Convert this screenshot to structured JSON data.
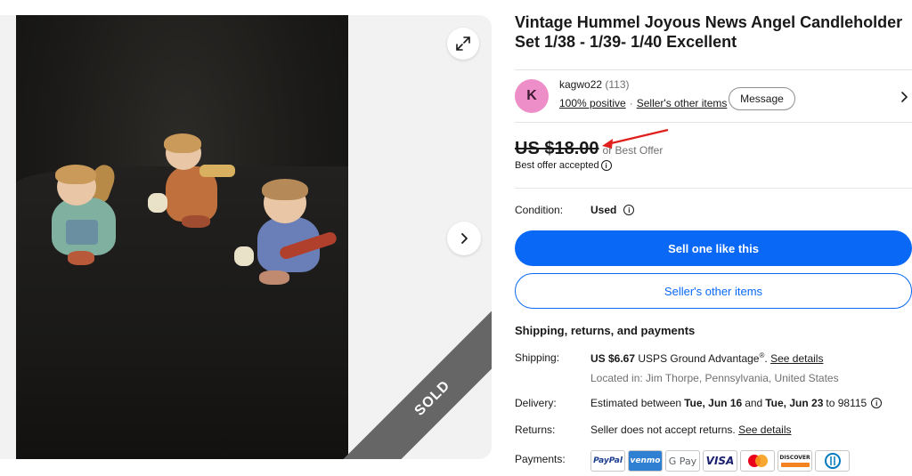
{
  "listing": {
    "title": "Vintage Hummel Joyous News Angel Candleholder Set 1/38 - 1/39- 1/40 Excellent",
    "sold_label": "SOLD"
  },
  "seller": {
    "avatar_letter": "K",
    "name": "kagwo22",
    "feedback_count": "(113)",
    "positive": "100% positive",
    "other_items": "Seller's other items",
    "message_label": "Message"
  },
  "price": {
    "amount": "US $18.00",
    "or_best_offer": "or Best Offer",
    "offer_accepted": "Best offer accepted"
  },
  "condition": {
    "label": "Condition:",
    "value": "Used"
  },
  "actions": {
    "sell_one": "Sell one like this",
    "sellers_other_items": "Seller's other items"
  },
  "details": {
    "section_title": "Shipping, returns, and payments",
    "shipping_label": "Shipping:",
    "shipping_price": "US $6.67",
    "shipping_service": "USPS Ground Advantage",
    "shipping_reg": "®",
    "see_details": "See details",
    "location": "Located in: Jim Thorpe, Pennsylvania, United States",
    "delivery_label": "Delivery:",
    "delivery_prefix": "Estimated between",
    "delivery_start": "Tue, Jun 16",
    "delivery_and": "and",
    "delivery_end": "Tue, Jun 23",
    "delivery_zip": "to 98115",
    "returns_label": "Returns:",
    "returns_text": "Seller does not accept returns.",
    "payments_label": "Payments:"
  },
  "payment_methods": [
    "PayPal",
    "venmo",
    "G Pay",
    "VISA",
    "Mastercard",
    "DISCOVER",
    "Diners Club"
  ],
  "colors": {
    "primary_blue": "#0968f6",
    "avatar_pink": "#ee8ec8",
    "sold_ribbon": "#666666",
    "annotation_arrow": "#e0201c"
  }
}
